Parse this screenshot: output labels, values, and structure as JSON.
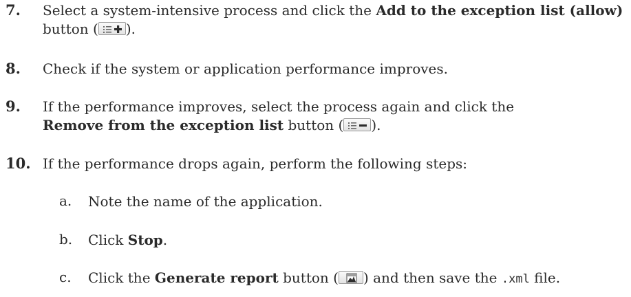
{
  "steps": [
    {
      "number": "7.",
      "pre": "Select a system-intensive process and click the ",
      "bold": "Add to the exception list (allow)",
      "post1": " button (",
      "post2": ").",
      "icon": "list-add-icon"
    },
    {
      "number": "8.",
      "text": "Check if the system or application performance improves."
    },
    {
      "number": "9.",
      "pre": "If the performance improves, select the process again and click the",
      "bold": "Remove from the exception list",
      "post1": " button (",
      "post2": ").",
      "icon": "list-remove-icon"
    },
    {
      "number": "10.",
      "text": "If the performance drops again, perform the following steps:",
      "substeps": [
        {
          "letter": "a.",
          "text": "Note the name of the application."
        },
        {
          "letter": "b.",
          "pre": "Click ",
          "bold": "Stop",
          "post": "."
        },
        {
          "letter": "c.",
          "pre": "Click the ",
          "bold": "Generate report",
          "post1": " button (",
          "post2": ") and then save the ",
          "code": ".xml",
          "post3": " file.",
          "icon": "report-icon"
        }
      ]
    }
  ]
}
